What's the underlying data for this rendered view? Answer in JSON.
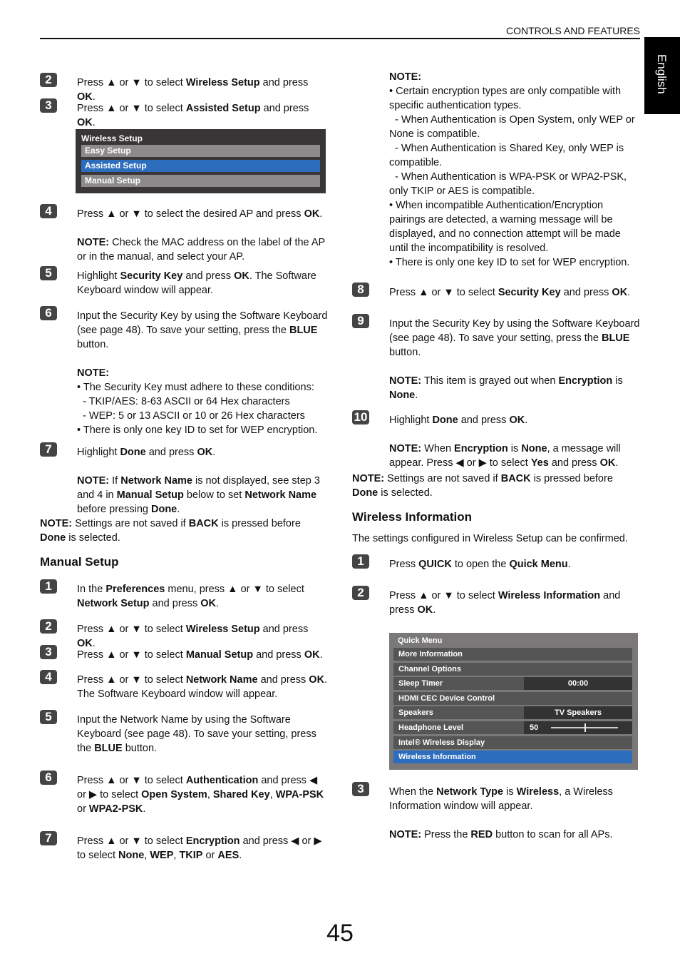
{
  "header": {
    "section": "CONTROLS AND FEATURES",
    "language_tab": "English"
  },
  "page_number": "45",
  "left": {
    "steps_a": [
      {
        "n": "2",
        "html": "Press ▲ or ▼ to select <b>Wireless Setup</b> and press <b>OK</b>."
      },
      {
        "n": "3",
        "html": "Press ▲ or ▼ to select <b>Assisted Setup</b> and press <b>OK</b>."
      }
    ],
    "wireless_menu": {
      "title": "Wireless Setup",
      "items": [
        "Easy Setup",
        "Assisted Setup",
        "Manual Setup"
      ],
      "selected": 1
    },
    "steps_b": [
      {
        "n": "4",
        "html": "Press ▲ or ▼ to select the desired AP and press <b>OK</b>.<br><br><b>NOTE:</b> Check the MAC address on the label of the AP or in the manual, and select your AP."
      },
      {
        "n": "5",
        "html": "Highlight <b>Security Key</b> and press <b>OK</b>. The Software Keyboard window will appear."
      },
      {
        "n": "6",
        "html": "Input the Security Key by using the Software Keyboard (see page 48). To save your setting, press the <b>BLUE</b> button.<br><br><b>NOTE:</b><br>• The Security Key must adhere to these conditions:<br>&nbsp;&nbsp;- TKIP/AES: 8-63 ASCII or 64 Hex characters<br>&nbsp;&nbsp;- WEP: 5 or 13 ASCII or 10 or 26 Hex characters<br>• There is only one key ID to set for WEP encryption."
      },
      {
        "n": "7",
        "html": "Highlight <b>Done</b> and press <b>OK</b>.<br><br><b>NOTE:</b> If <b>Network Name</b> is not displayed, see step 3 and 4 in <b>Manual Setup</b> below to set <b>Network Name</b> before pressing <b>Done</b>."
      }
    ],
    "note_back": "<b>NOTE:</b> Settings are not saved if <b>BACK</b> is pressed before <b>Done</b> is selected.",
    "manual_title": "Manual Setup",
    "manual_steps": [
      {
        "n": "1",
        "html": "In the <b>Preferences</b> menu, press ▲ or ▼ to select <b>Network Setup</b> and press <b>OK</b>."
      },
      {
        "n": "2",
        "html": "Press ▲ or ▼ to select <b>Wireless Setup</b> and press <b>OK</b>."
      },
      {
        "n": "3",
        "html": "Press ▲ or ▼ to select <b>Manual Setup</b> and press <b>OK</b>."
      },
      {
        "n": "4",
        "html": "Press ▲ or ▼ to select <b>Network Name</b> and press <b>OK</b>. The Software Keyboard window will appear."
      },
      {
        "n": "5",
        "html": "Input the Network Name by using the Software Keyboard (see page 48). To save your setting, press the <b>BLUE</b> button."
      },
      {
        "n": "6",
        "html": "Press ▲ or ▼ to select <b>Authentication</b> and press ◀ or ▶ to select <b>Open System</b>, <b>Shared Key</b>, <b>WPA-PSK</b> or <b>WPA2-PSK</b>."
      },
      {
        "n": "7",
        "html": "Press ▲ or ▼ to select <b>Encryption</b> and press ◀ or ▶ to select <b>None</b>, <b>WEP</b>, <b>TKIP</b> or <b>AES</b>."
      }
    ]
  },
  "right": {
    "note_top": "<b>NOTE:</b><br>• Certain encryption types are only compatible with specific authentication types.<br>&nbsp;&nbsp;- When Authentication is Open System, only WEP or None is compatible.<br>&nbsp;&nbsp;- When Authentication is Shared Key, only WEP is compatible.<br>&nbsp;&nbsp;- When Authentication is WPA-PSK or WPA2-PSK, only TKIP or AES is compatible.<br>• When incompatible Authentication/Encryption pairings are detected, a warning message will be displayed, and no connection attempt will be made until the incompatibility is resolved.<br>• There is only one key ID to set for WEP encryption.",
    "steps": [
      {
        "n": "8",
        "html": "Press ▲ or ▼ to select <b>Security Key</b> and press <b>OK</b>."
      },
      {
        "n": "9",
        "html": "Input the Security Key by using the Software Keyboard (see page 48). To save your setting, press the <b>BLUE</b> button.<br><br><b>NOTE:</b> This item is grayed out when <b>Encryption</b> is <b>None</b>."
      },
      {
        "n": "10",
        "html": "Highlight <b>Done</b> and press <b>OK</b>.<br><br><b>NOTE:</b> When <b>Encryption</b> is <b>None</b>, a message will appear. Press ◀ or ▶ to select <b>Yes</b> and press <b>OK</b>."
      }
    ],
    "note_back": "<b>NOTE:</b> Settings are not saved if <b>BACK</b> is pressed before <b>Done</b> is selected.",
    "wi_title": "Wireless Information",
    "wi_intro": "The settings configured in Wireless Setup can be confirmed.",
    "wi_steps": [
      {
        "n": "1",
        "html": "Press <b>QUICK</b> to open the <b>Quick Menu</b>."
      },
      {
        "n": "2",
        "html": "Press ▲ or ▼ to select <b>Wireless Information</b> and press <b>OK</b>."
      },
      {
        "n": "3",
        "html": "When the <b>Network Type</b> is <b>Wireless</b>, a Wireless Information window will appear.<br><br><b>NOTE:</b> Press the <b>RED</b> button to scan for all APs."
      }
    ],
    "quick_menu": {
      "title": "Quick Menu",
      "rows": [
        {
          "label": "More Information",
          "value": null
        },
        {
          "label": "Channel Options",
          "value": null
        },
        {
          "label": "Sleep Timer",
          "value": "00:00"
        },
        {
          "label": "HDMI CEC Device Control",
          "value": null
        },
        {
          "label": "Speakers",
          "value": "TV Speakers"
        },
        {
          "label": "Headphone Level",
          "value": "50",
          "slider_percent": 50
        },
        {
          "label": "Intel® Wireless Display",
          "value": null
        },
        {
          "label": "Wireless Information",
          "value": null,
          "selected": true
        }
      ]
    }
  }
}
